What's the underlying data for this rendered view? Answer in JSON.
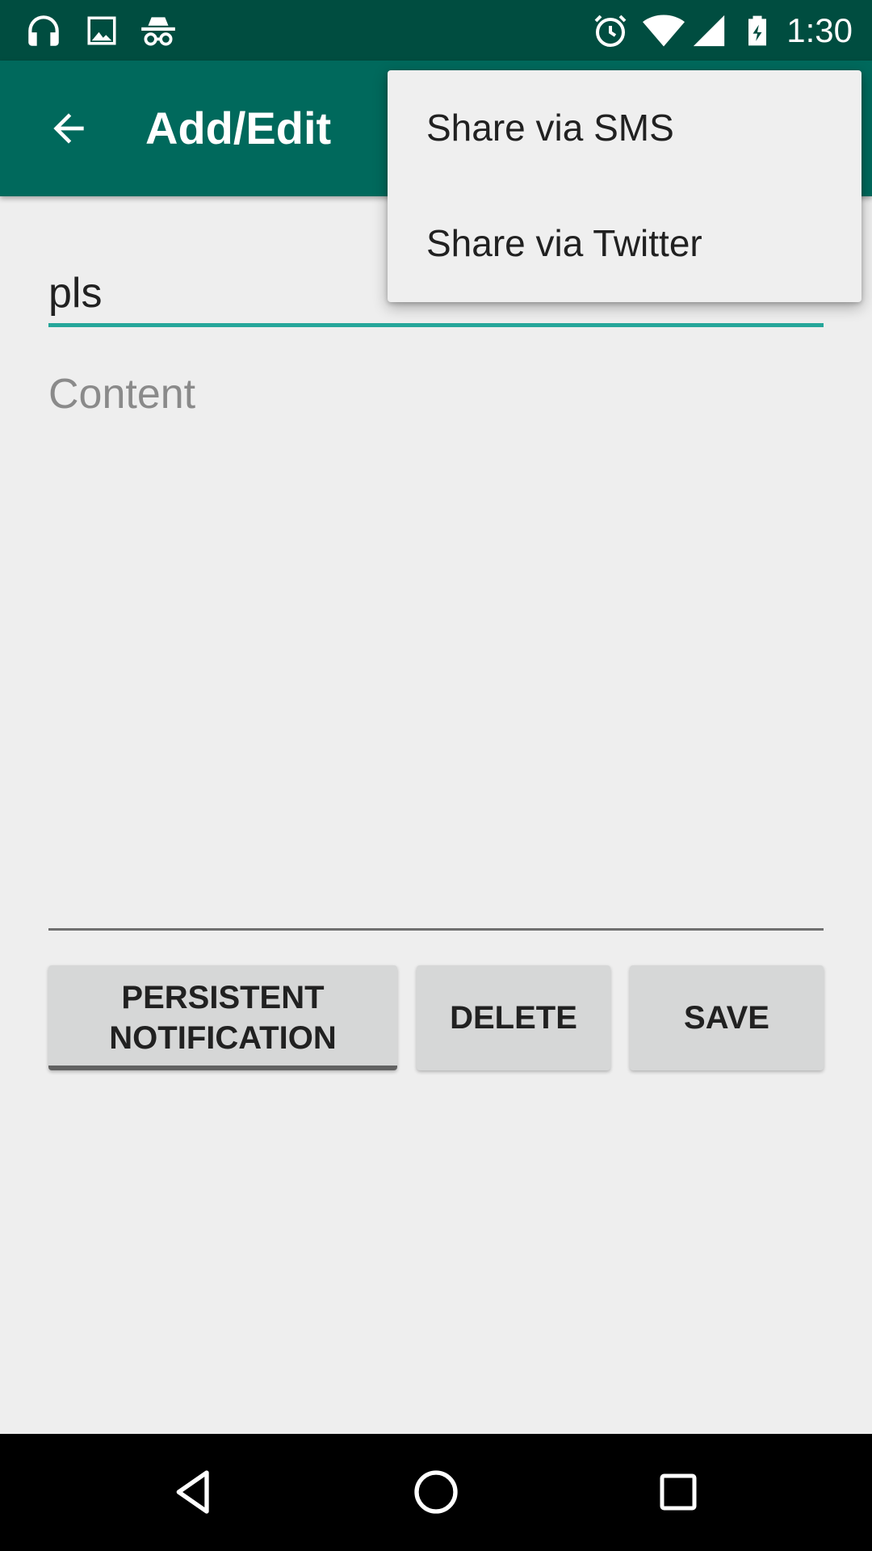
{
  "status_bar": {
    "time": "1:30",
    "left_icons": [
      "headphones-icon",
      "image-icon",
      "incognito-icon"
    ],
    "right_icons": [
      "alarm-icon",
      "wifi-icon",
      "cell-signal-icon",
      "battery-charging-icon"
    ]
  },
  "app_bar": {
    "title": "Add/Edit",
    "back_icon": "arrow-back-icon"
  },
  "form": {
    "title_value": "pls",
    "content_value": "",
    "content_placeholder": "Content"
  },
  "buttons": {
    "persistent_line1": "PERSISTENT",
    "persistent_line2": "NOTIFICATION",
    "delete": "DELETE",
    "save": "SAVE"
  },
  "overflow_menu": {
    "items": [
      {
        "label": "Share via SMS"
      },
      {
        "label": "Share via Twitter"
      }
    ]
  },
  "nav_bar": {
    "icons": [
      "back-triangle-icon",
      "home-circle-icon",
      "recents-square-icon"
    ]
  },
  "colors": {
    "status_bar": "#004d40",
    "app_bar": "#00695c",
    "accent": "#26a69a",
    "background": "#eeeeee"
  }
}
